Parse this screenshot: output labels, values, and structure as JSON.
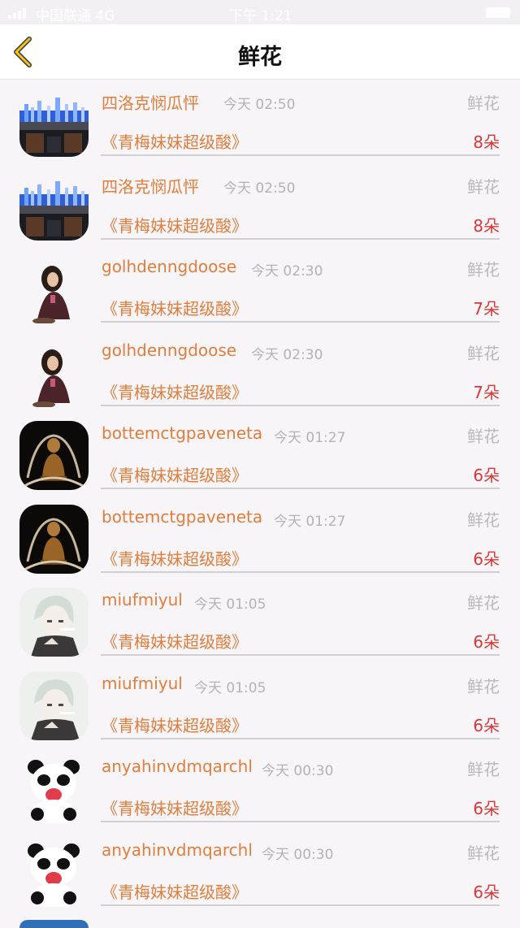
{
  "status_bar": {
    "carrier": "中国联通  4G",
    "time": "下午 1:21"
  },
  "nav": {
    "title": "鲜花"
  },
  "rows": [
    {
      "name": "四洛克悯瓜怦",
      "time": "今天 02:50",
      "type": "鲜花",
      "book": "《青梅妹妹超级酸》",
      "count": "8朵",
      "avatar": "city-night"
    },
    {
      "name": "四洛克悯瓜怦",
      "time": "今天 02:50",
      "type": "鲜花",
      "book": "《青梅妹妹超级酸》",
      "count": "8朵",
      "avatar": "city-night"
    },
    {
      "name": "golhdenngdoose",
      "time": "今天 02:30",
      "type": "鲜花",
      "book": "《青梅妹妹超级酸》",
      "count": "7朵",
      "avatar": "girl-sand"
    },
    {
      "name": "golhdenngdoose",
      "time": "今天 02:30",
      "type": "鲜花",
      "book": "《青梅妹妹超级酸》",
      "count": "7朵",
      "avatar": "girl-sand"
    },
    {
      "name": "bottemctgpaveneta",
      "time": "今天 01:27",
      "type": "鲜花",
      "book": "《青梅妹妹超级酸》",
      "count": "6朵",
      "avatar": "statue-dark"
    },
    {
      "name": "bottemctgpaveneta",
      "time": "今天 01:27",
      "type": "鲜花",
      "book": "《青梅妹妹超级酸》",
      "count": "6朵",
      "avatar": "statue-dark"
    },
    {
      "name": "miufmiyul",
      "time": "今天 01:05",
      "type": "鲜花",
      "book": "《青梅妹妹超级酸》",
      "count": "6朵",
      "avatar": "anime-boy"
    },
    {
      "name": "miufmiyul",
      "time": "今天 01:05",
      "type": "鲜花",
      "book": "《青梅妹妹超级酸》",
      "count": "6朵",
      "avatar": "anime-boy"
    },
    {
      "name": "anyahinvdmqarchl",
      "time": "今天 00:30",
      "type": "鲜花",
      "book": "《青梅妹妹超级酸》",
      "count": "6朵",
      "avatar": "panda"
    },
    {
      "name": "anyahinvdmqarchl",
      "time": "今天 00:30",
      "type": "鲜花",
      "book": "《青梅妹妹超级酸》",
      "count": "6朵",
      "avatar": "panda"
    }
  ],
  "colors": {
    "accent": "#e07e3c",
    "count": "#d83838",
    "muted": "#b3b3b3",
    "back": "#f0c419"
  }
}
